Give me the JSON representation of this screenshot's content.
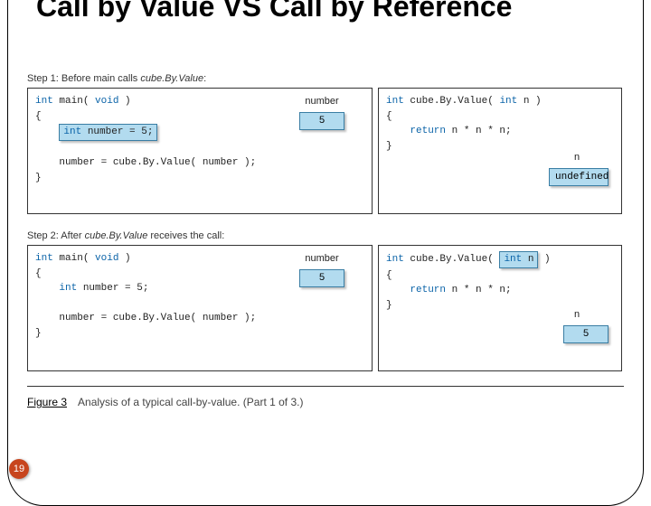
{
  "title": "Call by Value VS Call by Reference",
  "slide_number": "19",
  "figure": {
    "label": "Figure 3",
    "caption": "Analysis of a typical call-by-value. (Part 1 of 3.)"
  },
  "step1": {
    "label_pre": "Step 1: Before main calls ",
    "label_fn": "cube.By.Value",
    "label_post": ":",
    "main_l1a": "int",
    "main_l1b": " main( ",
    "main_l1c": "void",
    "main_l1d": " )",
    "main_l2": "{",
    "main_l3a": "int",
    "main_l3b": " number = 5;",
    "main_l4": "    number = cube.By.Value( number );",
    "main_l5": "}",
    "main_var": "number",
    "main_val": "5",
    "fn_l1a": "int",
    "fn_l1b": " cube.By.Value( ",
    "fn_l1c": "int",
    "fn_l1d": " n )",
    "fn_l2": "{",
    "fn_l3a": "return",
    "fn_l3b": " n * n * n;",
    "fn_l4": "}",
    "fn_var": "n",
    "fn_val": "undefined"
  },
  "step2": {
    "label_pre": "Step 2: After ",
    "label_fn": "cube.By.Value",
    "label_post": " receives the call:",
    "main_l1a": "int",
    "main_l1b": " main( ",
    "main_l1c": "void",
    "main_l1d": " )",
    "main_l2": "{",
    "main_l3a": "int",
    "main_l3b": " number = 5;",
    "main_l4": "    number = cube.By.Value( number );",
    "main_l5": "}",
    "main_var": "number",
    "main_val": "5",
    "fn_l1a": "int",
    "fn_l1b": " cube.By.Value( ",
    "fn_l1c": "int",
    "fn_l1d": " n",
    "fn_l1e": " )",
    "fn_l2": "{",
    "fn_l3a": "return",
    "fn_l3b": " n * n * n;",
    "fn_l4": "}",
    "fn_var": "n",
    "fn_val": "5"
  }
}
